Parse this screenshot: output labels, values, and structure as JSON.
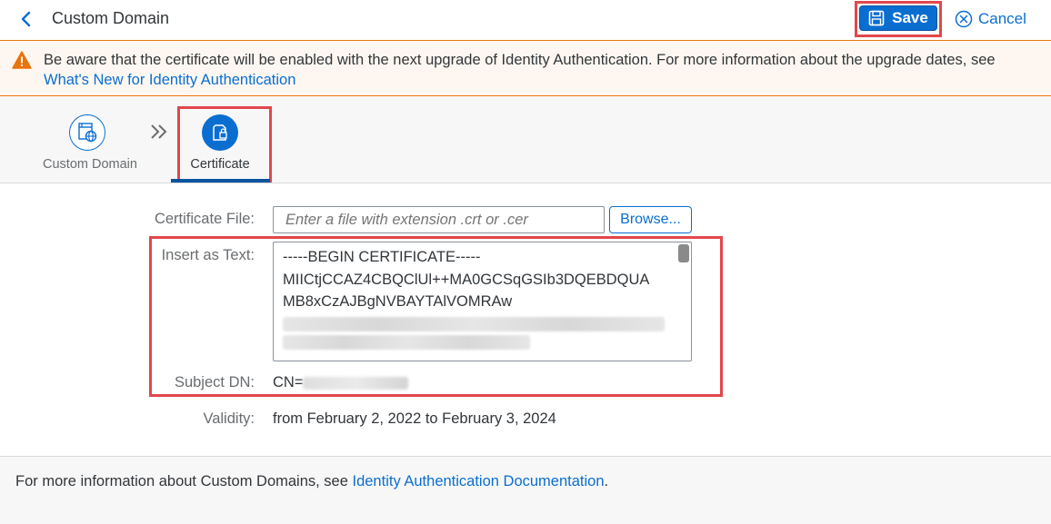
{
  "header": {
    "title": "Custom Domain",
    "save_label": "Save",
    "cancel_label": "Cancel"
  },
  "warning": {
    "text": "Be aware that the certificate will be enabled with the next upgrade of Identity Authentication. For more information about the upgrade dates, see ",
    "link": "What's New for Identity Authentication"
  },
  "wizard": {
    "steps": [
      {
        "label": "Custom Domain",
        "icon": "globe-document-icon"
      },
      {
        "label": "Certificate",
        "icon": "certificate-lock-icon",
        "active": true
      }
    ]
  },
  "form": {
    "certificate_file": {
      "label": "Certificate File:",
      "placeholder": "Enter a file with extension .crt or .cer",
      "browse_label": "Browse..."
    },
    "insert_as_text": {
      "label": "Insert as Text:",
      "lines": [
        "-----BEGIN CERTIFICATE-----",
        "MIICtjCCAZ4CBQClUl++MA0GCSqGSIb3DQEBDQUA",
        "MB8xCzAJBgNVBAYTAlVOMRAw"
      ]
    },
    "subject_dn": {
      "label": "Subject DN:",
      "value_prefix": "CN="
    },
    "validity": {
      "label": "Validity:",
      "value": "from February 2, 2022 to February 3, 2024"
    }
  },
  "footer": {
    "text": "For more information about Custom Domains, see ",
    "link": "Identity Authentication Documentation",
    "suffix": "."
  },
  "colors": {
    "accent": "#0a6ed1",
    "highlight_border": "#e2474b",
    "warning": "#e9730c"
  }
}
